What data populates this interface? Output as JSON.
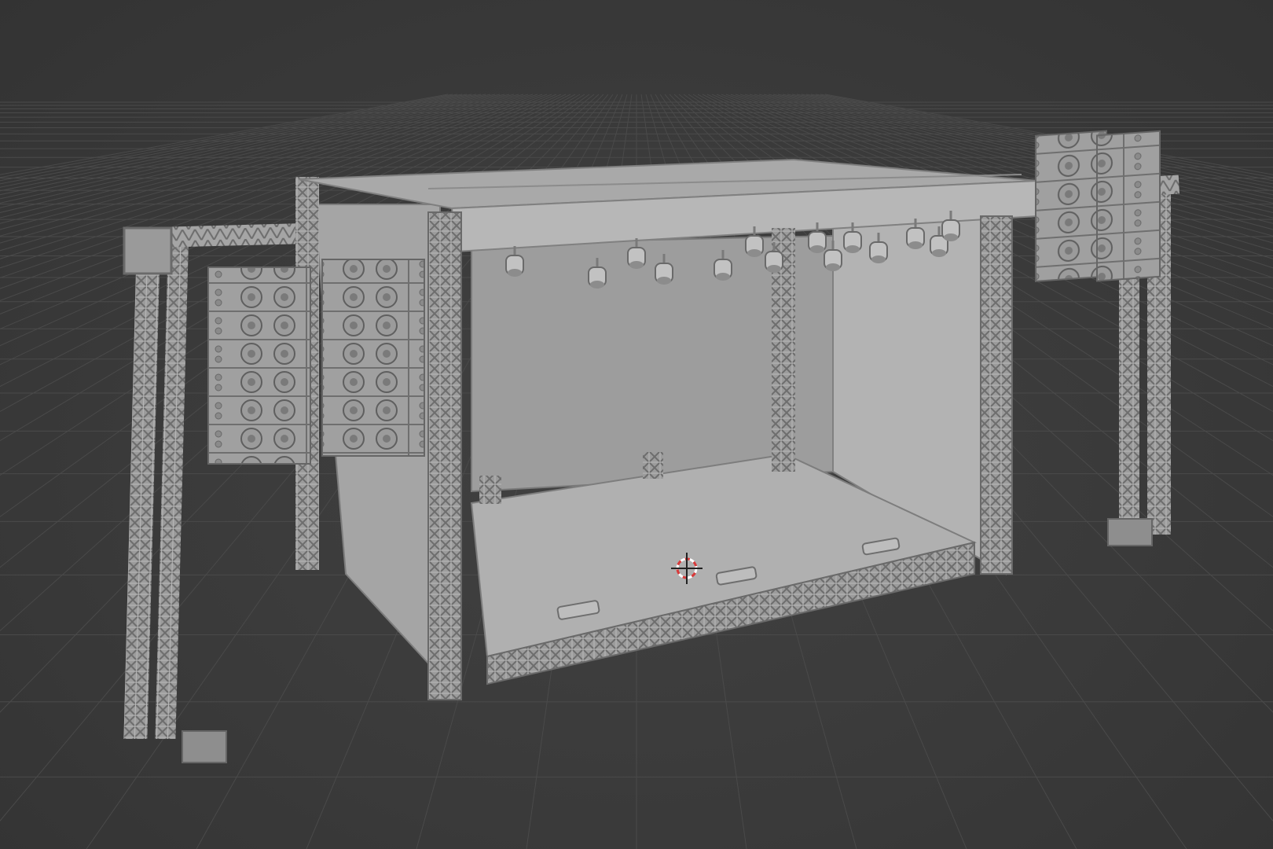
{
  "viewport": {
    "background_color": "#3b3b3b",
    "grid_color": "#4a4a4a",
    "model_color": "#a3a3a3",
    "model_shadow_color": "#7c7c7c",
    "cursor_color": "#d83a3a"
  },
  "scene": {
    "objects": [
      "stage-roof",
      "stage-floor",
      "stage-back-wall",
      "stage-side-wall-left",
      "stage-side-wall-right",
      "left-speaker-tower",
      "right-speaker-tower",
      "spotlight-rig"
    ],
    "left_speaker_array_columns": 2,
    "left_speaker_array_rows": 6,
    "right_speaker_array_columns": 2,
    "right_speaker_array_rows": 6,
    "spotlight_count": 14,
    "floor_monitor_count": 3,
    "icons": [
      "3d-cursor-icon"
    ]
  }
}
